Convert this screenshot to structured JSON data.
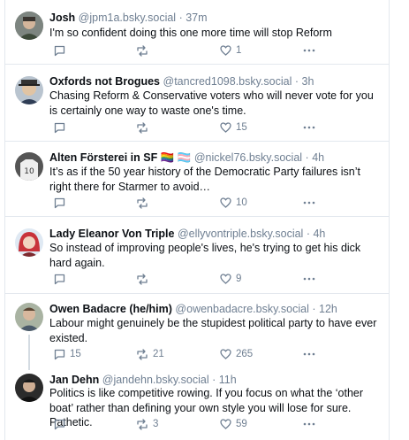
{
  "colors": {
    "border": "#e3e8ee",
    "muted": "#6f7f92",
    "text": "#0b0f14",
    "thread": "#d4dbe2"
  },
  "posts": [
    {
      "name": "Josh",
      "handle": "@jpm1a.bsky.social",
      "time": "37m",
      "text": "I'm so confident doing this one more time will stop Reform",
      "replies": "",
      "reposts": "",
      "likes": "1",
      "avatar_icon": "person-avatar"
    },
    {
      "name": "Oxfords not Brogues",
      "handle": "@tancred1098.bsky.social",
      "time": "3h",
      "text": "Chasing Reform & Conservative voters who will never vote for you is certainly one way to waste one's time.",
      "replies": "",
      "reposts": "",
      "likes": "15",
      "avatar_icon": "person-avatar"
    },
    {
      "name": "Alten Försterei in SF 🏳️‍🌈 🏳️‍⚧️",
      "handle": "@nickel76.bsky.social",
      "time": "4h",
      "text": "It’s as if the 50 year history of the Democratic Party failures isn’t right there for Starmer to avoid…",
      "replies": "",
      "reposts": "",
      "likes": "10",
      "avatar_icon": "jersey-avatar"
    },
    {
      "name": "Lady Eleanor Von Triple",
      "handle": "@ellyvontriple.bsky.social",
      "time": "4h",
      "text": "So instead of improving people's lives, he's trying to get his dick hard again.",
      "replies": "",
      "reposts": "",
      "likes": "9",
      "avatar_icon": "red-hair-avatar"
    },
    {
      "name": "Owen Badacre (he/him)",
      "handle": "@owenbadacre.bsky.social",
      "time": "12h",
      "text": "Labour might genuinely be the stupidest political party to have ever existed.",
      "replies": "15",
      "reposts": "21",
      "likes": "265",
      "avatar_icon": "person-avatar"
    },
    {
      "name": "Jan Dehn",
      "handle": "@jandehn.bsky.social",
      "time": "11h",
      "text": "Politics is like competitive rowing. If you focus on what the ‘other boat’ rather than defining your own style you will lose for sure. Pathetic.",
      "replies": "",
      "reposts": "3",
      "likes": "59",
      "avatar_icon": "person-avatar"
    }
  ]
}
